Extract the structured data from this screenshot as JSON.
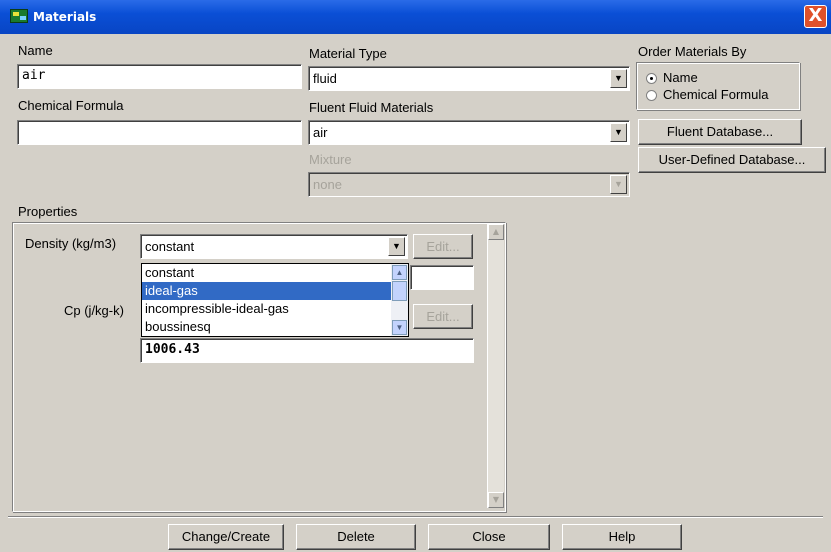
{
  "window": {
    "title": "Materials",
    "close_glyph": "X"
  },
  "name": {
    "label": "Name",
    "value": "air"
  },
  "chemical_formula": {
    "label": "Chemical Formula",
    "value": ""
  },
  "material_type": {
    "label": "Material Type",
    "value": "fluid"
  },
  "fluent_fluid_materials": {
    "label": "Fluent Fluid Materials",
    "value": "air"
  },
  "mixture": {
    "label": "Mixture",
    "value": "none"
  },
  "order_by": {
    "label": "Order Materials By",
    "options": [
      {
        "label": "Name",
        "selected": true
      },
      {
        "label": "Chemical Formula",
        "selected": false
      }
    ]
  },
  "side_buttons": {
    "fluent_db": "Fluent Database...",
    "user_db": "User-Defined Database..."
  },
  "properties": {
    "label": "Properties",
    "density_label": "Density (kg/m3)",
    "density_value": "constant",
    "edit_label": "Edit...",
    "cp_label": "Cp (j/kg-k)",
    "cp_value": "1006.43",
    "dropdown_options": [
      "constant",
      "ideal-gas",
      "incompressible-ideal-gas",
      "boussinesq"
    ],
    "dropdown_selected_index": 1
  },
  "footer": {
    "change_create": "Change/Create",
    "delete": "Delete",
    "close": "Close",
    "help": "Help"
  },
  "colors": {
    "titlebar": "#0a4fd6",
    "selection": "#316ac5",
    "dialog_bg": "#d4d0c8"
  },
  "icons": {
    "dropdown_arrow": "▼",
    "scroll_up": "▲",
    "scroll_down": "▼"
  }
}
